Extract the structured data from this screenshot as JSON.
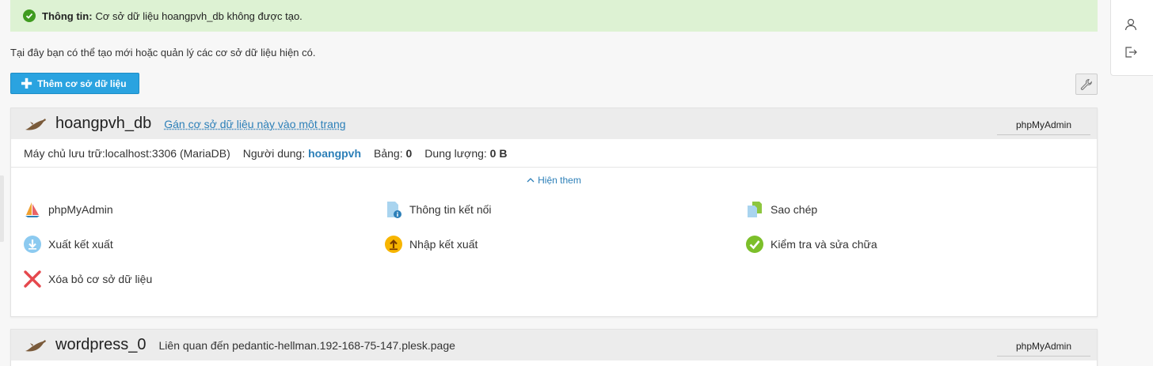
{
  "alert": {
    "label": "Thông tin:",
    "message": "Cơ sở dữ liệu hoangpvh_db không được tạo."
  },
  "intro": "Tại đây bạn có thể tạo mới hoặc quản lý các cơ sở dữ liệu hiện có.",
  "toolbar": {
    "add_label": "Thêm cơ sở dữ liệu"
  },
  "databases": [
    {
      "name": "hoangpvh_db",
      "assign_link": "Gán cơ sở dữ liệu này vào một trang",
      "pma_button": "phpMyAdmin",
      "host_label": "Máy chủ lưu trữ:",
      "host_value": "localhost:3306 (MariaDB)",
      "user_label": "Người dung:",
      "user_value": "hoangpvh",
      "tables_label": "Bảng:",
      "tables_value": "0",
      "size_label": "Dung lượng:",
      "size_value": "0 B",
      "show_more": "Hiện them",
      "actions": {
        "phpmyadmin": "phpMyAdmin",
        "connection": "Thông tin kết nối",
        "copy": "Sao chép",
        "export": "Xuất kết xuất",
        "import": "Nhập kết xuất",
        "check": "Kiểm tra và sửa chữa",
        "delete": "Xóa bỏ cơ sở dữ liệu"
      }
    },
    {
      "name": "wordpress_0",
      "related": "Liên quan đến pedantic-hellman.192-168-75-147.plesk.page",
      "pma_button": "phpMyAdmin"
    }
  ],
  "colors": {
    "accent": "#2aa3e0",
    "link": "#2c7fb8",
    "success_bg": "#ddf2d3",
    "success_icon": "#3f9b1f",
    "danger": "#e5484d"
  }
}
